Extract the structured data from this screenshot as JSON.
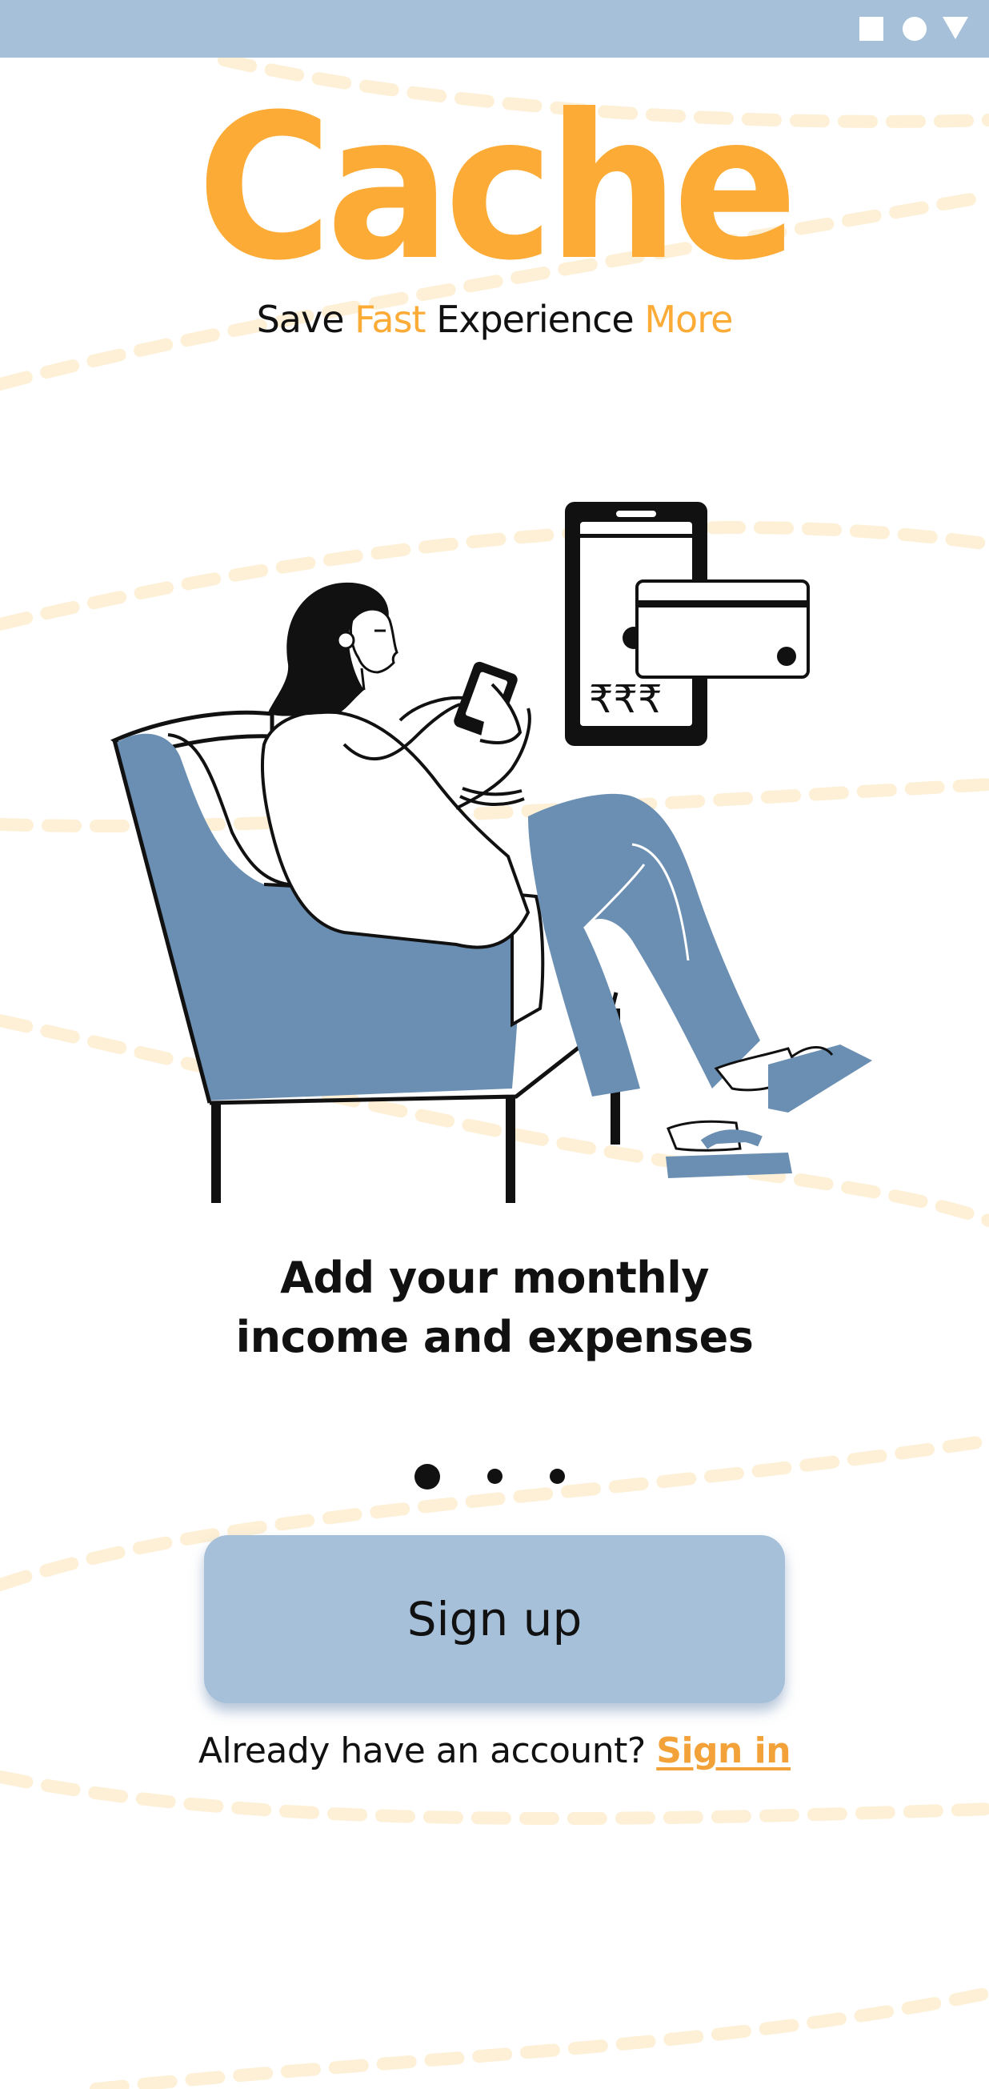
{
  "status_bar": {
    "background": "#a6c0da",
    "icons": [
      "square-icon",
      "circle-icon",
      "triangle-icon"
    ]
  },
  "brand": {
    "logo_text": "Cache",
    "tagline": {
      "part1": "Save ",
      "part2": "Fast",
      "part3": " Experience ",
      "part4": "More"
    },
    "accent_color": "#fbab36"
  },
  "illustration": {
    "icon": "woman-on-armchair-with-phone-illustration",
    "currency_text": "₹₹₹"
  },
  "onboarding": {
    "headline_line1": "Add your monthly",
    "headline_line2": "income and expenses",
    "pager": {
      "total_pages": 3,
      "active_page": 1
    }
  },
  "actions": {
    "signup_label": "Sign up",
    "signup_color": "#a6c0da",
    "signin_prompt": "Already have an account? ",
    "signin_label": "Sign in",
    "signin_color": "#f2a238"
  }
}
